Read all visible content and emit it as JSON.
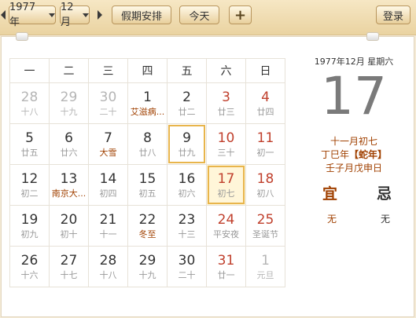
{
  "toolbar": {
    "year_label": "1977 年",
    "month_label": "12月",
    "holiday_label": "假期安排",
    "today_label": "今天",
    "add_label": "+",
    "login_label": "登录"
  },
  "weekdays": [
    "一",
    "二",
    "三",
    "四",
    "五",
    "六",
    "日"
  ],
  "weeks": [
    [
      {
        "d": "28",
        "l": "十八",
        "g": true
      },
      {
        "d": "29",
        "l": "十九",
        "g": true
      },
      {
        "d": "30",
        "l": "二十",
        "g": true
      },
      {
        "d": "1",
        "l": "艾滋病...",
        "f": true
      },
      {
        "d": "2",
        "l": "廿二"
      },
      {
        "d": "3",
        "l": "廿三",
        "w": true
      },
      {
        "d": "4",
        "l": "廿四",
        "w": true
      }
    ],
    [
      {
        "d": "5",
        "l": "廿五"
      },
      {
        "d": "6",
        "l": "廿六"
      },
      {
        "d": "7",
        "l": "大雪",
        "f": true
      },
      {
        "d": "8",
        "l": "廿八"
      },
      {
        "d": "9",
        "l": "廿九",
        "hl": true
      },
      {
        "d": "10",
        "l": "三十",
        "w": true
      },
      {
        "d": "11",
        "l": "初一",
        "w": true
      }
    ],
    [
      {
        "d": "12",
        "l": "初二"
      },
      {
        "d": "13",
        "l": "南京大...",
        "f": true
      },
      {
        "d": "14",
        "l": "初四"
      },
      {
        "d": "15",
        "l": "初五"
      },
      {
        "d": "16",
        "l": "初六"
      },
      {
        "d": "17",
        "l": "初七",
        "w": true,
        "today": true
      },
      {
        "d": "18",
        "l": "初八",
        "w": true
      }
    ],
    [
      {
        "d": "19",
        "l": "初九"
      },
      {
        "d": "20",
        "l": "初十"
      },
      {
        "d": "21",
        "l": "十一"
      },
      {
        "d": "22",
        "l": "冬至",
        "f": true
      },
      {
        "d": "23",
        "l": "十三"
      },
      {
        "d": "24",
        "l": "平安夜",
        "w": true
      },
      {
        "d": "25",
        "l": "圣诞节",
        "w": true
      }
    ],
    [
      {
        "d": "26",
        "l": "十六"
      },
      {
        "d": "27",
        "l": "十七"
      },
      {
        "d": "28",
        "l": "十八"
      },
      {
        "d": "29",
        "l": "十九"
      },
      {
        "d": "30",
        "l": "二十"
      },
      {
        "d": "31",
        "l": "廿一",
        "w": true
      },
      {
        "d": "1",
        "l": "元旦",
        "g": true
      }
    ]
  ],
  "side": {
    "date_line": "1977年12月  星期六",
    "big_day": "17",
    "lunar_line": "十一月初七",
    "year_gz_prefix": "丁巳年",
    "zodiac": "【蛇年】",
    "month_day_gz": "壬子月戊申日",
    "yi_label": "宜",
    "ji_label": "忌",
    "yi_value": "无",
    "ji_value": "无"
  },
  "colors": {
    "red": "#c0402d",
    "gold": "#e8b54c",
    "brown": "#a04000"
  }
}
